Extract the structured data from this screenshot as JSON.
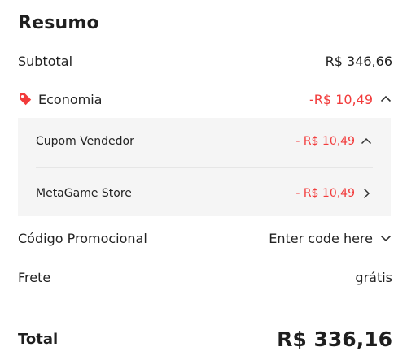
{
  "summary": {
    "title": "Resumo",
    "subtotal": {
      "label": "Subtotal",
      "value": "R$ 346,66"
    },
    "economia": {
      "label": "Economia",
      "value": "-R$ 10,49",
      "icon": "tag-icon",
      "expanded": true,
      "details": [
        {
          "label": "Cupom Vendedor",
          "value": "- R$ 10,49",
          "icon": "chevron-up-icon"
        },
        {
          "label": "MetaGame Store",
          "value": "- R$ 10,49",
          "icon": "chevron-right-icon"
        }
      ]
    },
    "promo": {
      "label": "Código Promocional",
      "value": "Enter code here",
      "icon": "chevron-down-icon"
    },
    "shipping": {
      "label": "Frete",
      "value": "grátis"
    },
    "total": {
      "label": "Total",
      "value": "R$ 336,16"
    }
  },
  "colors": {
    "accent_red": "#f23b3b",
    "text": "#222222",
    "details_bg": "#f5f5f5"
  }
}
